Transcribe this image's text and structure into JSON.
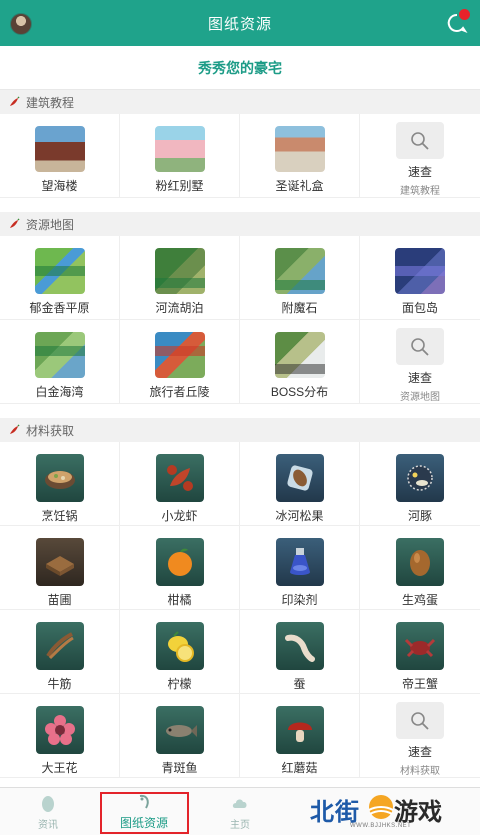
{
  "header": {
    "title": "图纸资源"
  },
  "slogan": "秀秀您的豪宅",
  "sections": [
    {
      "title": "建筑教程",
      "items": [
        {
          "label": "望海楼",
          "thumb": "t-bld1"
        },
        {
          "label": "粉红别墅",
          "thumb": "t-bld2"
        },
        {
          "label": "圣诞礼盒",
          "thumb": "t-bld3"
        },
        {
          "label": "速查",
          "sub": "建筑教程",
          "search": true
        }
      ]
    },
    {
      "title": "资源地图",
      "items": [
        {
          "label": "郁金香平原",
          "thumb": "t-map1"
        },
        {
          "label": "河流胡泊",
          "thumb": "t-map2"
        },
        {
          "label": "附魔石",
          "thumb": "t-map3"
        },
        {
          "label": "面包岛",
          "thumb": "t-map4"
        },
        {
          "label": "白金海湾",
          "thumb": "t-map5"
        },
        {
          "label": "旅行者丘陵",
          "thumb": "t-map6"
        },
        {
          "label": "BOSS分布",
          "thumb": "t-map7"
        },
        {
          "label": "速查",
          "sub": "资源地图",
          "search": true
        }
      ]
    },
    {
      "title": "材料获取",
      "items": [
        {
          "label": "烹饪锅",
          "icon": "cooking-pot-icon"
        },
        {
          "label": "小龙虾",
          "icon": "crayfish-icon"
        },
        {
          "label": "冰河松果",
          "icon": "glacier-pinecone-icon"
        },
        {
          "label": "河豚",
          "icon": "pufferfish-icon"
        },
        {
          "label": "苗圃",
          "icon": "nursery-icon"
        },
        {
          "label": "柑橘",
          "icon": "orange-icon"
        },
        {
          "label": "印染剂",
          "icon": "dye-bottle-icon"
        },
        {
          "label": "生鸡蛋",
          "icon": "raw-egg-icon"
        },
        {
          "label": "牛筋",
          "icon": "beef-tendon-icon"
        },
        {
          "label": "柠檬",
          "icon": "lemon-icon"
        },
        {
          "label": "蚕",
          "icon": "silkworm-icon"
        },
        {
          "label": "帝王蟹",
          "icon": "king-crab-icon"
        },
        {
          "label": "大王花",
          "icon": "rafflesia-icon"
        },
        {
          "label": "青斑鱼",
          "icon": "grouper-icon"
        },
        {
          "label": "红蘑菇",
          "icon": "red-mushroom-icon"
        },
        {
          "label": "速查",
          "sub": "材料获取",
          "search": true
        }
      ]
    }
  ],
  "bottom_nav": {
    "tabs": [
      {
        "label": "资讯"
      },
      {
        "label": "图纸资源"
      },
      {
        "label": "主页"
      }
    ]
  },
  "watermark": {
    "name_a": "北街",
    "name_b": "游戏",
    "url": "WWW.BJJHKS.NET"
  },
  "colors": {
    "accent": "#1fa38b",
    "highlight": "#e3232a",
    "section_bg": "#f1f1f1"
  }
}
